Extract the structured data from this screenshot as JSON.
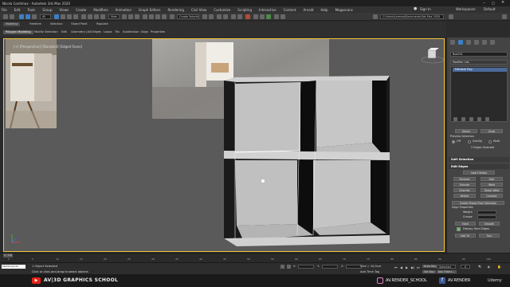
{
  "app": {
    "title": "Nicola Contimax - Autodesk 3ds Max 2020"
  },
  "menu": {
    "items": [
      "File",
      "Edit",
      "Tools",
      "Group",
      "Views",
      "Create",
      "Modifiers",
      "Animation",
      "Graph Editors",
      "Rendering",
      "Civil View",
      "Customize",
      "Scripting",
      "Interactive",
      "Content",
      "Arnold",
      "Help",
      "Megascans"
    ],
    "sign_in": "Sign In",
    "workspaces_label": "Workspaces:",
    "workspace_value": "Default"
  },
  "toolbar": {
    "view_dropdown": "View",
    "selection_set": "Create Selection Se",
    "path": "C:\\Users\\Lorenzo\\Documents\\3ds Max 2020"
  },
  "ribbon": {
    "tabs": [
      "Modeling",
      "Freeform",
      "Selection",
      "Object Paint",
      "Populate"
    ],
    "panels": [
      "Polygon Modeling",
      "Modify Selection",
      "Edit",
      "Geometry (All)",
      "Edges",
      "Loops",
      "Tris",
      "Subdivision",
      "Align",
      "Properties"
    ]
  },
  "viewport": {
    "label": "[+] [Perspective] [Standard] [Edged Faces]"
  },
  "cmdpanel": {
    "object_name": "Box001",
    "modifier_list": "Modifier List",
    "stack_item": "Editable Poly",
    "preview_selection_label": "Preview Selection",
    "preview_options": [
      "Off",
      "SubObj",
      "Multi"
    ],
    "selected_status": "2 Edges Selected",
    "soft_selection": "Soft Selection",
    "edit_edges": "Edit Edges",
    "insert_vertex": "Insert Vertex",
    "remove": "Remove",
    "split": "Split",
    "extrude": "Extrude",
    "weld": "Weld",
    "chamfer": "Chamfer",
    "target_weld": "Target Weld",
    "bridge": "Bridge",
    "connect": "Connect",
    "create_shape": "Create Shape From Selection",
    "edge_properties": "Edge Properties",
    "weight": "Weight",
    "crease": "Crease",
    "hard": "Hard",
    "smooth": "Smooth",
    "display_hard": "Display Hard Edges",
    "edit_tri": "Edit Tri.",
    "turn": "Turn"
  },
  "timeline": {
    "frame_readout": "0 / 100",
    "ticks": [
      "0",
      "5",
      "10",
      "15",
      "20",
      "25",
      "30",
      "35",
      "40",
      "45",
      "50",
      "55",
      "60",
      "65",
      "70",
      "75",
      "80",
      "85",
      "90",
      "95",
      "100"
    ]
  },
  "status": {
    "selected": "1 Object Selected",
    "hint": "Click or click-and-drag to select objects",
    "x_label": "X:",
    "y_label": "Y:",
    "z_label": "Z:",
    "grid": "Grid = 10,0cm",
    "add_time_tag": "Add Time Tag",
    "auto_key": "Auto Key",
    "set_key": "Set Key",
    "selected_dd": "Selected",
    "key_filters": "Key Filters...",
    "frame": "0",
    "script_listener": "MAXScript Mi"
  },
  "footer": {
    "school": "AV|3D GRAPHICS SCHOOL",
    "instagram": "AV.RENDER_SCHOOL",
    "facebook": "AV.RENDER",
    "udemy": "Udemy"
  },
  "colors": {
    "accent": "#f3c53c",
    "youtube": "#e62117",
    "active_check": "#5cc85c"
  }
}
